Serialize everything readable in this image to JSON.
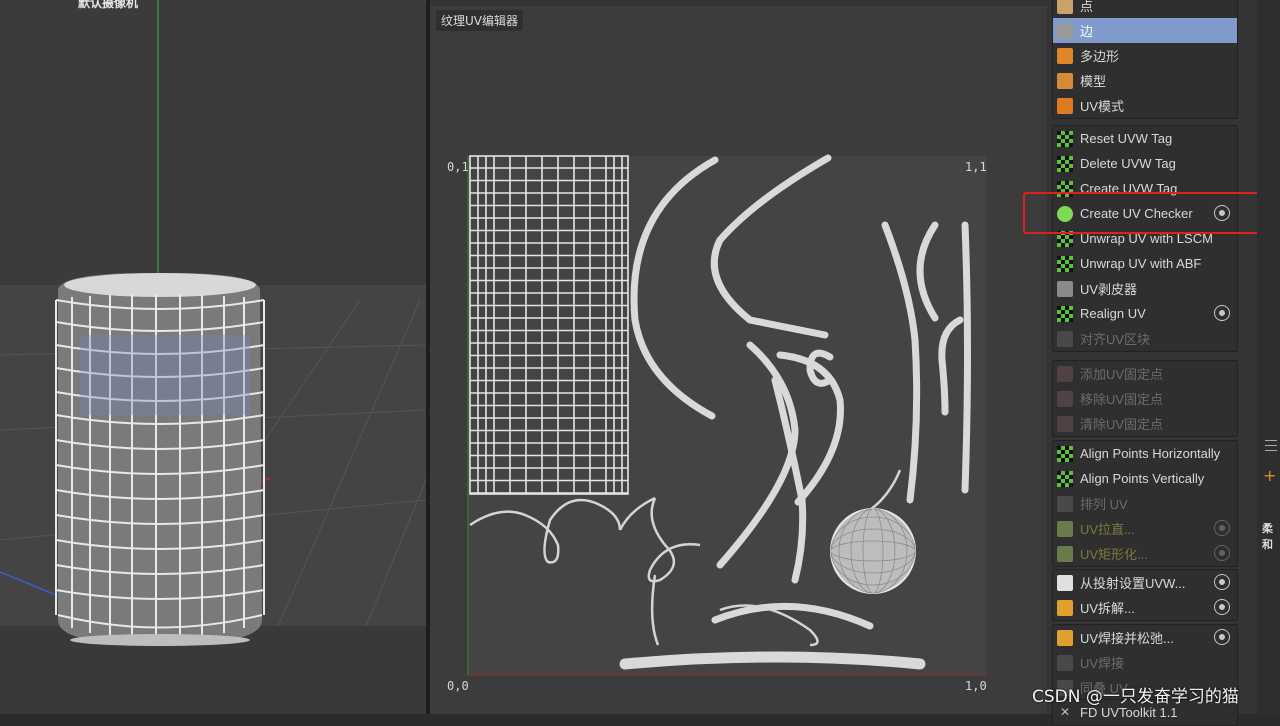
{
  "viewport": {
    "camera_label": "默认摄像机"
  },
  "uv_editor": {
    "tab_label": "纹理UV编辑器",
    "corner_top_left": "0,1",
    "corner_top_right": "1,1",
    "corner_bottom_left": "0,0",
    "corner_bottom_right": "1,0"
  },
  "panel": {
    "groups": [
      {
        "items": [
          {
            "label": "点",
            "icon": "point-mode-icon"
          },
          {
            "label": "边",
            "icon": "edge-mode-icon",
            "selected": true
          },
          {
            "label": "多边形",
            "icon": "polygon-mode-icon"
          },
          {
            "label": "模型",
            "icon": "model-mode-icon"
          },
          {
            "label": "UV模式",
            "icon": "uv-mode-icon"
          }
        ]
      },
      {
        "items": [
          {
            "label": "Reset UVW Tag",
            "icon": "checker-icon"
          },
          {
            "label": "Delete UVW Tag",
            "icon": "checker-icon"
          },
          {
            "label": "Create UVW Tag",
            "icon": "checker-icon"
          },
          {
            "label": "Create UV Checker",
            "icon": "sphere-checker-icon",
            "gear": true
          },
          {
            "label": "Unwrap UV with LSCM",
            "icon": "lscm-icon"
          },
          {
            "label": "Unwrap UV with ABF",
            "icon": "abf-icon"
          },
          {
            "label": "UV剥皮器",
            "icon": "peeler-icon"
          },
          {
            "label": "Realign UV",
            "icon": "realign-icon",
            "gear": true
          },
          {
            "label": "对齐UV区块",
            "icon": "align-island-icon",
            "disabled": true
          }
        ]
      },
      {
        "items": [
          {
            "label": "添加UV固定点",
            "icon": "pin-add-icon",
            "disabled": true
          },
          {
            "label": "移除UV固定点",
            "icon": "pin-remove-icon",
            "disabled": true
          },
          {
            "label": "清除UV固定点",
            "icon": "pin-clear-icon",
            "disabled": true
          }
        ]
      },
      {
        "items": [
          {
            "label": "Align Points Horizontally",
            "icon": "align-h-icon"
          },
          {
            "label": "Align Points Vertically",
            "icon": "align-v-icon"
          },
          {
            "label": "排列 UV",
            "icon": "arrange-icon",
            "disabled": true
          },
          {
            "label": "UV拉直...",
            "icon": "straighten-icon",
            "disabled2": true,
            "gear": true
          },
          {
            "label": "UV矩形化...",
            "icon": "rectangle-icon",
            "disabled2": true,
            "gear": true
          }
        ]
      },
      {
        "items": [
          {
            "label": "从投射设置UVW...",
            "icon": "projection-icon",
            "gear": true
          },
          {
            "label": "UV拆解...",
            "icon": "unfold-icon",
            "gear": true
          }
        ]
      },
      {
        "items": [
          {
            "label": "UV焊接并松弛...",
            "icon": "weld-relax-icon",
            "gear": true
          },
          {
            "label": "UV焊接",
            "icon": "weld-icon",
            "disabled": true
          },
          {
            "label": "同叠 UV",
            "icon": "stack-icon",
            "disabled": true
          }
        ]
      },
      {
        "items": [
          {
            "label": "FD UVToolkit 1.1",
            "icon": "close-icon"
          }
        ]
      }
    ]
  },
  "right_strip": {
    "label": "柔和"
  },
  "watermark": "CSDN @一只发奋学习的猫",
  "colors": {
    "selection": "#7f9acb",
    "highlight_box": "#e0201c",
    "uv_lines": "#d9d9d9",
    "icon_green": "#5ac23a"
  }
}
